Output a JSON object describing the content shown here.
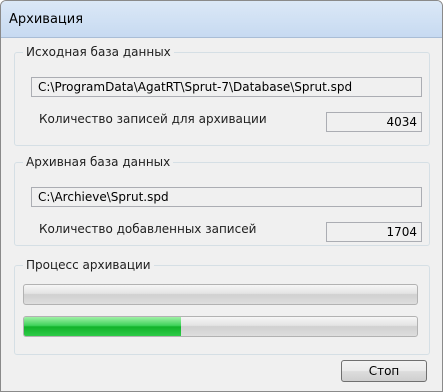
{
  "window": {
    "title": "Архивация"
  },
  "source_group": {
    "legend": "Исходная база данных",
    "path": "C:\\ProgramData\\AgatRT\\Sprut-7\\Database\\Sprut.spd",
    "count_label": "Количество записей для архивации",
    "count_value": "4034"
  },
  "archive_group": {
    "legend": "Архивная база данных",
    "path": "C:\\Archieve\\Sprut.spd",
    "count_label": "Количество добавленных записей",
    "count_value": "1704"
  },
  "process_group": {
    "legend": "Процесс архивации",
    "progress_overall": 0,
    "progress_current": 0.4,
    "progress_color": "#1fbf39"
  },
  "buttons": {
    "stop_label": "Стоп"
  }
}
